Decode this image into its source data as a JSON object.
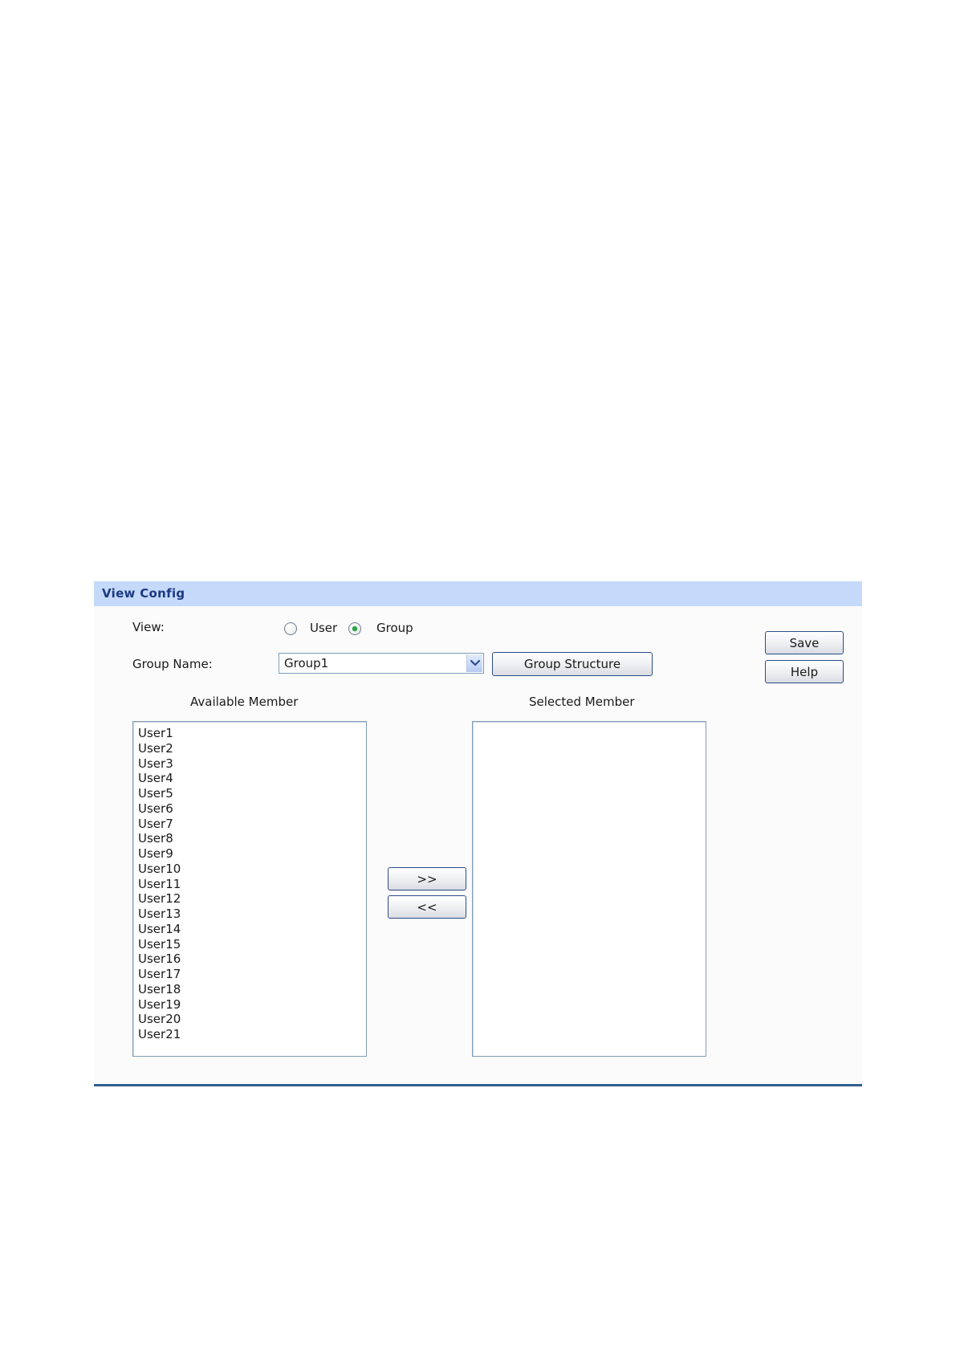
{
  "panel": {
    "title": "View Config"
  },
  "view": {
    "label": "View:",
    "options": [
      {
        "label": "User",
        "selected": false
      },
      {
        "label": "Group",
        "selected": true
      }
    ]
  },
  "group_name": {
    "label": "Group Name:",
    "value": "Group1",
    "structure_button": "Group Structure"
  },
  "actions": {
    "save": "Save",
    "help": "Help",
    "add": ">>",
    "remove": "<<"
  },
  "available": {
    "label": "Available Member",
    "items": [
      "User1",
      "User2",
      "User3",
      "User4",
      "User5",
      "User6",
      "User7",
      "User8",
      "User9",
      "User10",
      "User11",
      "User12",
      "User13",
      "User14",
      "User15",
      "User16",
      "User17",
      "User18",
      "User19",
      "User20",
      "User21"
    ]
  },
  "selected": {
    "label": "Selected Member",
    "items": []
  },
  "colors": {
    "header_bg": "#c5d9fa",
    "header_text": "#1b3a82",
    "rule": "#2e5f8e",
    "radio_dot": "#28a745"
  }
}
